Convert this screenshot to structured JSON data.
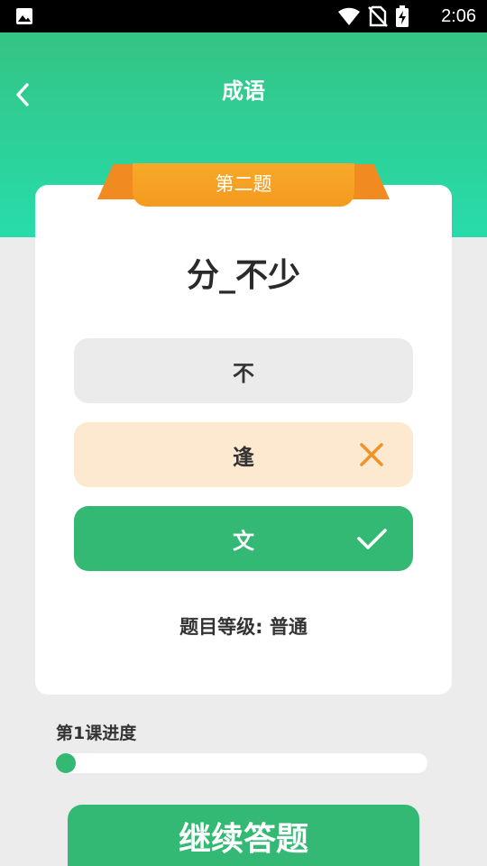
{
  "status_bar": {
    "time": "2:06",
    "icons": [
      "gallery-icon",
      "wifi-icon",
      "no-sim-icon",
      "battery-charging-icon"
    ]
  },
  "header": {
    "title": "成语",
    "back_icon": "chevron-left-icon"
  },
  "quiz": {
    "question_number": "第二题",
    "question": "分_不少",
    "options": [
      {
        "label": "不",
        "state": "neutral"
      },
      {
        "label": "逢",
        "state": "wrong",
        "icon": "close-icon"
      },
      {
        "label": "文",
        "state": "correct",
        "icon": "check-icon"
      }
    ],
    "level_text": "题目等级: 普通"
  },
  "progress": {
    "label": "第1课进度",
    "value": 0.0
  },
  "continue_button": {
    "label": "继续答题"
  },
  "colors": {
    "green": "#33b974",
    "header_gradient_top": "#36c07e",
    "header_gradient_bottom": "#27dcab",
    "orange": "#f49a1f",
    "wrong_bg": "#fde9cf",
    "neutral_bg": "#ebebeb"
  }
}
